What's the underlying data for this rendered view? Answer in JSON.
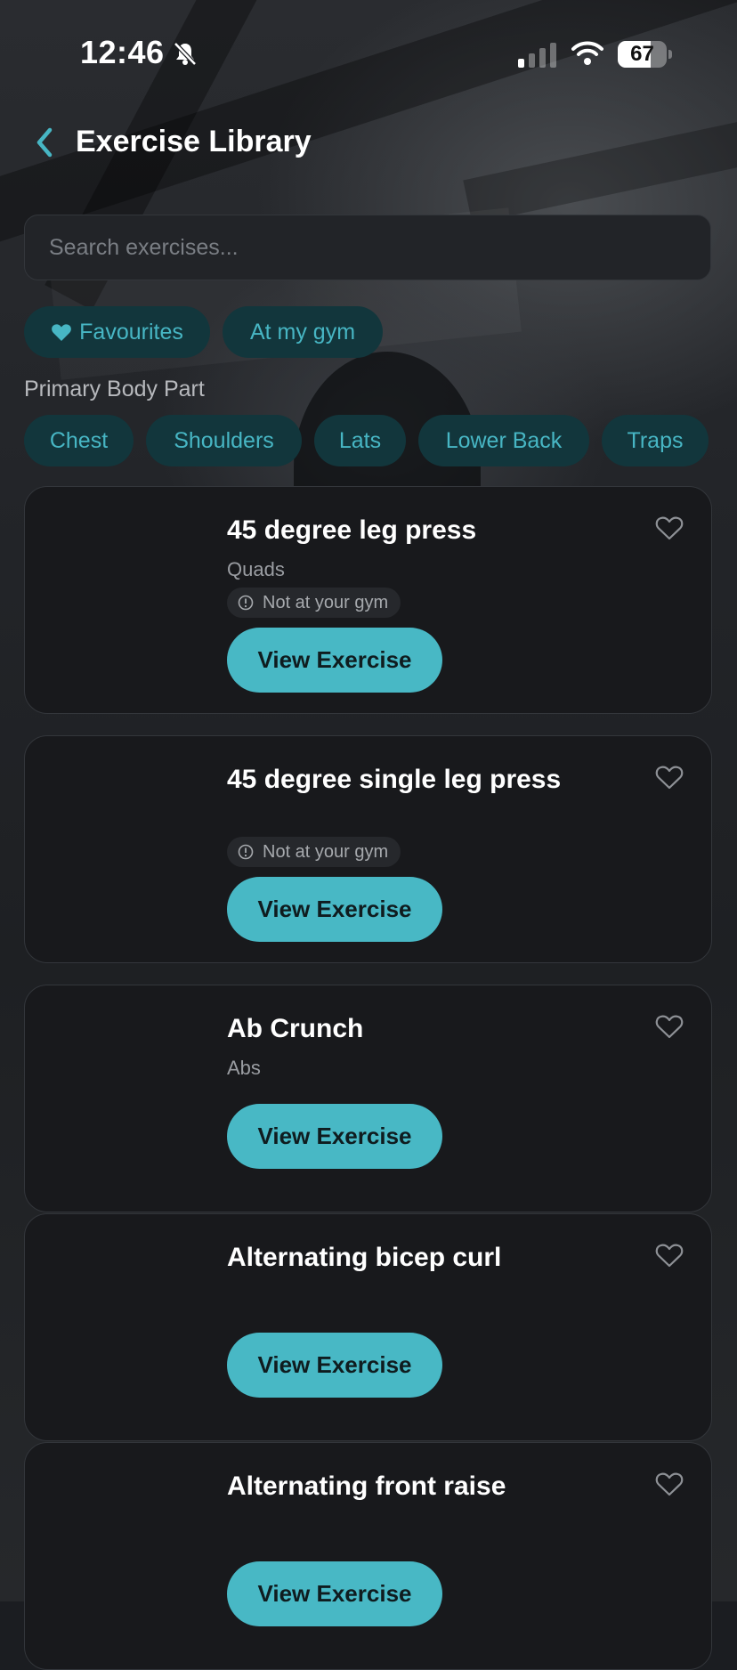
{
  "status_bar": {
    "time": "12:46",
    "battery": "67",
    "battery_level": 0.67
  },
  "header": {
    "title": "Exercise Library"
  },
  "search": {
    "placeholder": "Search exercises..."
  },
  "filters": {
    "favourites": "Favourites",
    "at_my_gym": "At my gym"
  },
  "body_part": {
    "label": "Primary Body Part",
    "chips": [
      "Chest",
      "Shoulders",
      "Lats",
      "Lower Back",
      "Traps"
    ]
  },
  "exercises": [
    {
      "name": "45 degree leg press",
      "muscle": "Quads",
      "badge": "Not at your gym",
      "button": "View Exercise"
    },
    {
      "name": "45 degree single leg press",
      "muscle": "",
      "badge": "Not at your gym",
      "button": "View Exercise"
    },
    {
      "name": "Ab Crunch",
      "muscle": "Abs",
      "badge": "",
      "button": "View Exercise"
    },
    {
      "name": "Alternating bicep curl",
      "muscle": "",
      "badge": "",
      "button": "View Exercise"
    },
    {
      "name": "Alternating front raise",
      "muscle": "",
      "badge": "",
      "button": "View Exercise"
    }
  ],
  "colors": {
    "accent": "#48b8c5",
    "chip_bg": "#12363c",
    "card_bg": "#18191c"
  }
}
